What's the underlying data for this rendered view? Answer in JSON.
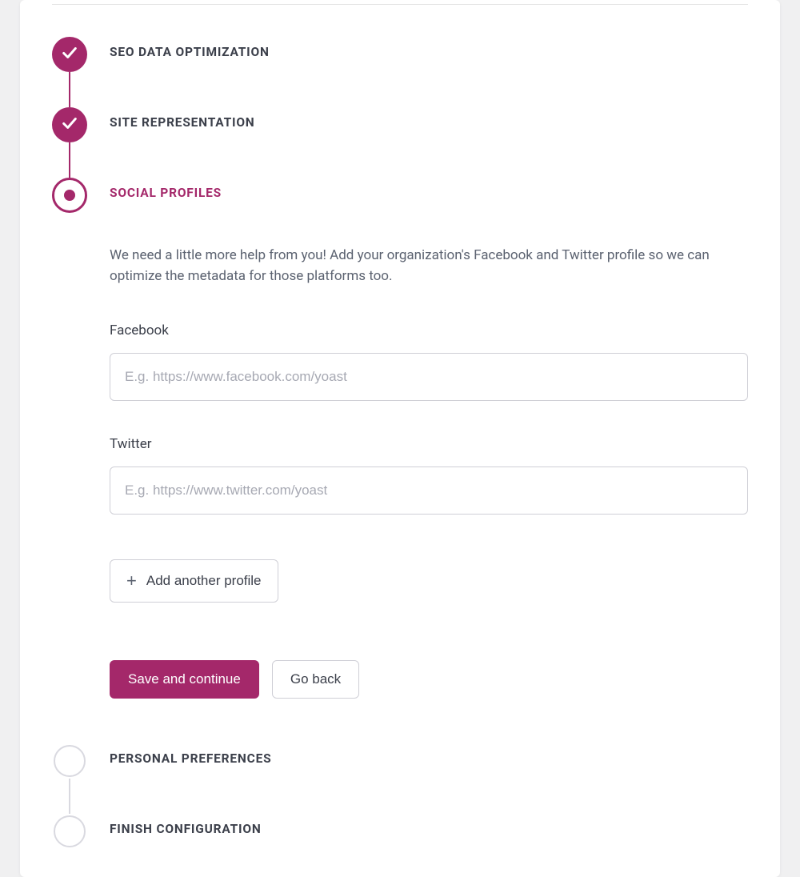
{
  "colors": {
    "accent": "#a4286a",
    "mutedLine": "#d9d9e0",
    "textPrimary": "#3b3f4a",
    "textMuted": "#5b6270",
    "border": "#cfcfd6"
  },
  "steps": {
    "seo": {
      "label": "SEO DATA OPTIMIZATION",
      "state": "completed"
    },
    "site": {
      "label": "SITE REPRESENTATION",
      "state": "completed"
    },
    "social": {
      "label": "SOCIAL PROFILES",
      "state": "active"
    },
    "personal": {
      "label": "PERSONAL PREFERENCES",
      "state": "pending"
    },
    "finish": {
      "label": "FINISH CONFIGURATION",
      "state": "pending"
    }
  },
  "social": {
    "intro": "We need a little more help from you! Add your organization's Facebook and Twitter profile so we can optimize the metadata for those platforms too.",
    "fields": {
      "facebook": {
        "label": "Facebook",
        "value": "",
        "placeholder": "E.g. https://www.facebook.com/yoast"
      },
      "twitter": {
        "label": "Twitter",
        "value": "",
        "placeholder": "E.g. https://www.twitter.com/yoast"
      }
    },
    "add_profile_label": "Add another profile",
    "save_label": "Save and continue",
    "back_label": "Go back"
  }
}
